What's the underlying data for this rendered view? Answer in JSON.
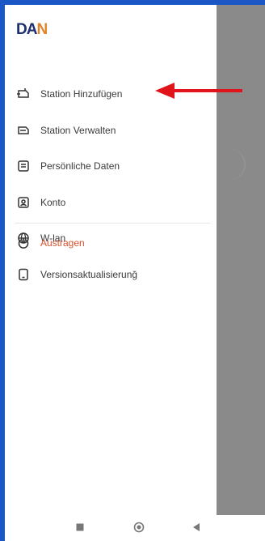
{
  "app": {
    "logo_text": "DAN",
    "logo_part1": "DA",
    "logo_part2": "N"
  },
  "menu": {
    "items": [
      {
        "label": "Station Hinzufügen",
        "icon": "add-station-icon"
      },
      {
        "label": "Station Verwalten",
        "icon": "manage-station-icon"
      },
      {
        "label": "Persönliche Daten",
        "icon": "personal-data-icon"
      },
      {
        "label": "Konto",
        "icon": "account-icon"
      },
      {
        "label": "W-lan",
        "icon": "globe-icon"
      },
      {
        "label": "Versionsaktualisierunğ",
        "icon": "phone-icon"
      }
    ],
    "logout": {
      "label": "Austragen",
      "icon": "power-icon"
    }
  },
  "colors": {
    "frame_border": "#1a56c4",
    "overlay": "#8a8a8a",
    "logout_accent": "#d8502e",
    "arrow": "#e0141a",
    "logo_primary": "#1c2f6e",
    "logo_accent": "#e0832a"
  },
  "navbar": {
    "buttons": [
      "square-icon",
      "circle-home-icon",
      "back-triangle-icon"
    ]
  }
}
